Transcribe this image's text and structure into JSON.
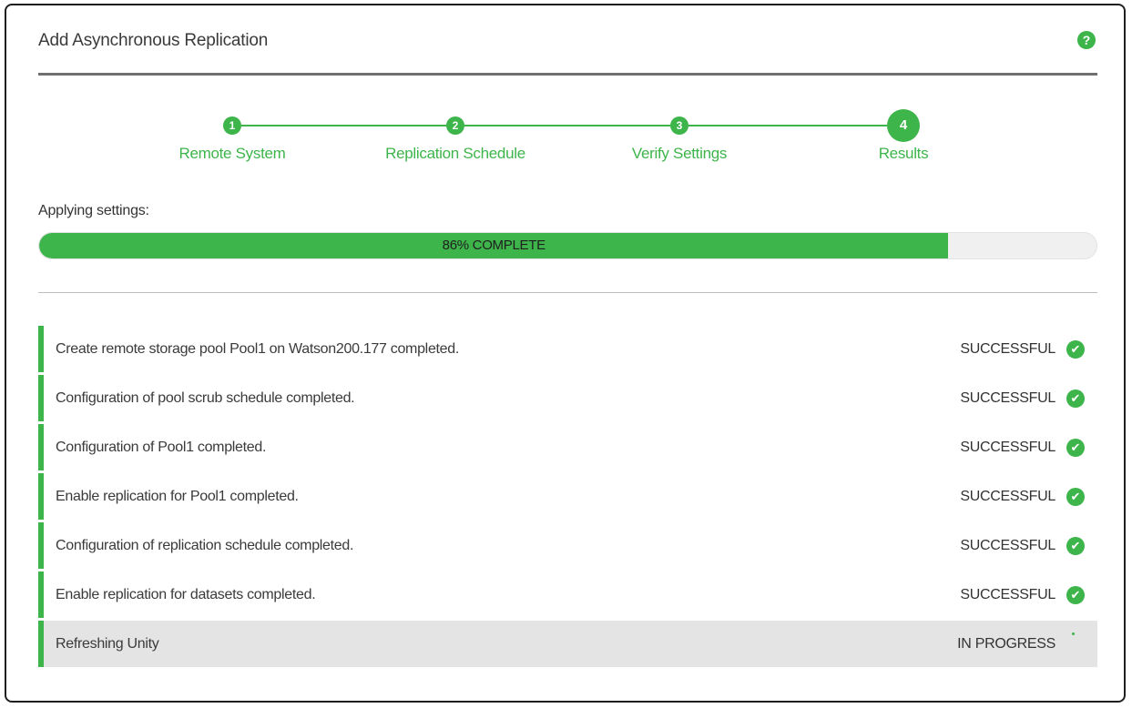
{
  "dialog": {
    "title": "Add Asynchronous Replication",
    "help_icon": "question-circle-icon",
    "help_glyph": "?"
  },
  "wizard": {
    "steps": [
      {
        "number": "1",
        "label": "Remote System",
        "state": "completed"
      },
      {
        "number": "2",
        "label": "Replication Schedule",
        "state": "completed"
      },
      {
        "number": "3",
        "label": "Verify Settings",
        "state": "completed"
      },
      {
        "number": "4",
        "label": "Results",
        "state": "current"
      }
    ]
  },
  "progress": {
    "heading": "Applying settings:",
    "percent": 86,
    "label": "86% COMPLETE"
  },
  "results": [
    {
      "message": "Create remote storage pool Pool1 on Watson200.177 completed.",
      "status": "SUCCESSFUL",
      "icon": "check-circle-icon"
    },
    {
      "message": "Configuration of pool scrub schedule completed.",
      "status": "SUCCESSFUL",
      "icon": "check-circle-icon"
    },
    {
      "message": "Configuration of Pool1 completed.",
      "status": "SUCCESSFUL",
      "icon": "check-circle-icon"
    },
    {
      "message": "Enable replication for Pool1 completed.",
      "status": "SUCCESSFUL",
      "icon": "check-circle-icon"
    },
    {
      "message": "Configuration of replication schedule completed.",
      "status": "SUCCESSFUL",
      "icon": "check-circle-icon"
    },
    {
      "message": "Enable replication for datasets completed.",
      "status": "SUCCESSFUL",
      "icon": "check-circle-icon"
    },
    {
      "message": "Refreshing Unity",
      "status": "IN PROGRESS",
      "icon": "spinner-icon"
    }
  ],
  "colors": {
    "accent": "#3db54a",
    "in_progress_row": "#e4e4e4"
  }
}
